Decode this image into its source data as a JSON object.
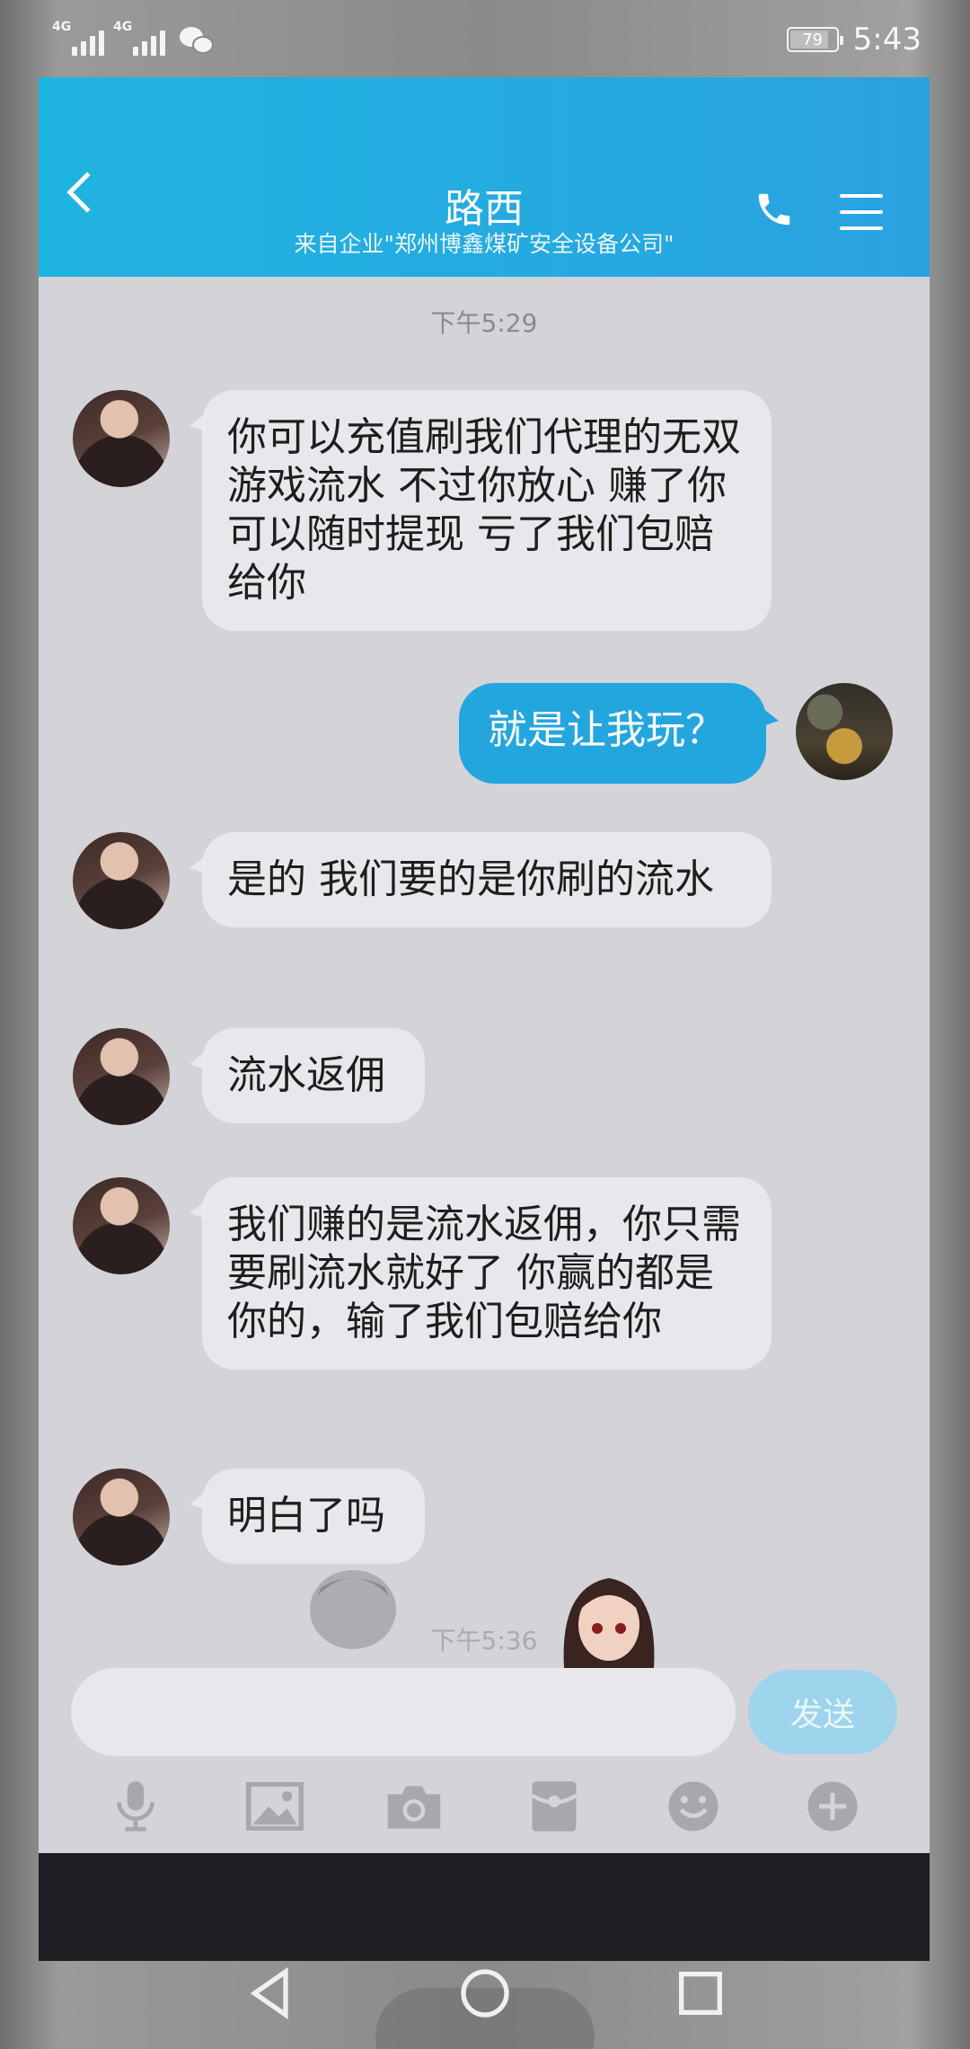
{
  "status_bar": {
    "network1": "4G",
    "network2": "4G",
    "battery": "79",
    "time": "5:43"
  },
  "header": {
    "title": "路西",
    "subtitle": "来自企业\"郑州博鑫煤矿安全设备公司\""
  },
  "timestamps": [
    "下午5:29",
    "下午5:36"
  ],
  "messages": [
    {
      "side": "in",
      "text": "你可以充值刷我们代理的无双游戏流水  不过你放心 赚了你可以随时提现  亏了我们包赔给你"
    },
    {
      "side": "out",
      "text": "就是让我玩？"
    },
    {
      "side": "in",
      "text": "是的  我们要的是你刷的流水"
    },
    {
      "side": "in",
      "text": "流水返佣"
    },
    {
      "side": "in",
      "text": "我们赚的是流水返佣，你只需要刷流水就好了  你赢的都是你的，输了我们包赔给你"
    },
    {
      "side": "in",
      "text": "明白了吗"
    }
  ],
  "composer": {
    "placeholder": "",
    "send_label": "发送"
  },
  "toolbar_icons": [
    "microphone-icon",
    "image-icon",
    "camera-icon",
    "red-packet-icon",
    "emoji-icon",
    "plus-icon"
  ],
  "colors": {
    "header": "#23a6de",
    "outgoing_bubble": "#23a6de",
    "incoming_bubble": "#ebebf0",
    "send_button": "#9ed4ec"
  }
}
